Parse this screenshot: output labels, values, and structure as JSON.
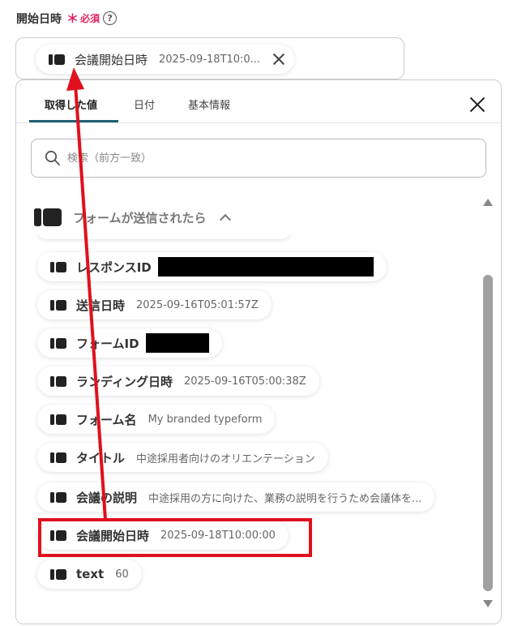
{
  "field": {
    "label": "開始日時",
    "required_mark": "＊",
    "required_text": "必須",
    "help": "?"
  },
  "selected": {
    "name": "会議開始日時",
    "value": "2025-09-18T10:0..."
  },
  "tabs": [
    {
      "label": "取得した値",
      "active": true
    },
    {
      "label": "日付",
      "active": false
    },
    {
      "label": "基本情報",
      "active": false
    }
  ],
  "search": {
    "placeholder": "検索（前方一致）"
  },
  "section": {
    "title": "フォームが送信されたら"
  },
  "items": [
    {
      "name": "レスポンスID",
      "value": ""
    },
    {
      "name": "送信日時",
      "value": "2025-09-16T05:01:57Z"
    },
    {
      "name": "フォームID",
      "value": ""
    },
    {
      "name": "ランディング日時",
      "value": "2025-09-16T05:00:38Z"
    },
    {
      "name": "フォーム名",
      "value": "My branded typeform"
    },
    {
      "name": "タイトル",
      "value": "中途採用者向けのオリエンテーション"
    },
    {
      "name": "会議の説明",
      "value": "中途採用の方に向けた、業務の説明を行うため会議体を..."
    },
    {
      "name": "会議開始日時",
      "value": "2025-09-18T10:00:00"
    },
    {
      "name": "text",
      "value": "60"
    }
  ],
  "colors": {
    "accent": "#1f5f74",
    "required": "#e0245e",
    "annotation": "#e0101e"
  }
}
